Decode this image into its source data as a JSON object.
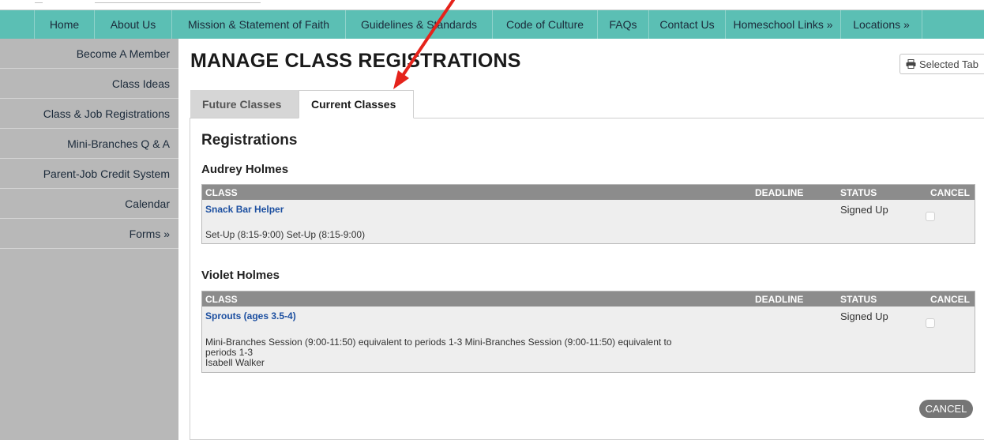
{
  "nav": {
    "items": [
      "Home",
      "About Us",
      "Mission & Statement of Faith",
      "Guidelines & Standards",
      "Code of Culture",
      "FAQs",
      "Contact Us",
      "Homeschool Links »",
      "Locations »"
    ]
  },
  "sidebar": {
    "items": [
      "Become A Member",
      "Class Ideas",
      "Class & Job Registrations",
      "Mini-Branches Q & A",
      "Parent-Job Credit System",
      "Calendar",
      "Forms »"
    ]
  },
  "page": {
    "title": "MANAGE CLASS REGISTRATIONS",
    "print_label": "Selected Tab",
    "print_icon": "printer-icon"
  },
  "tabs": [
    {
      "label": "Future Classes",
      "active": false
    },
    {
      "label": "Current Classes",
      "active": true
    }
  ],
  "registrations": {
    "heading": "Registrations",
    "columns": {
      "class": "CLASS",
      "deadline": "DEADLINE",
      "status": "STATUS",
      "cancel": "CANCEL"
    },
    "students": [
      {
        "name": "Audrey Holmes",
        "class_name": "Snack Bar Helper",
        "deadline": "",
        "status": "Signed Up",
        "description_lines": [
          "Set-Up (8:15-9:00) Set-Up (8:15-9:00)"
        ]
      },
      {
        "name": "Violet Holmes",
        "class_name": "Sprouts (ages 3.5-4)",
        "deadline": "",
        "status": "Signed Up",
        "description_lines": [
          "Mini-Branches Session (9:00-11:50) equivalent to periods 1-3 Mini-Branches Session (9:00-11:50) equivalent to",
          "periods 1-3",
          "Isabell Walker"
        ]
      }
    ],
    "cancel_button": "CANCEL"
  },
  "colors": {
    "nav_bg": "#5bbfb4",
    "sidebar_bg": "#b8b8b8",
    "table_header_bg": "#8c8c8c",
    "link": "#1c4fa0",
    "arrow": "#e5231b"
  }
}
